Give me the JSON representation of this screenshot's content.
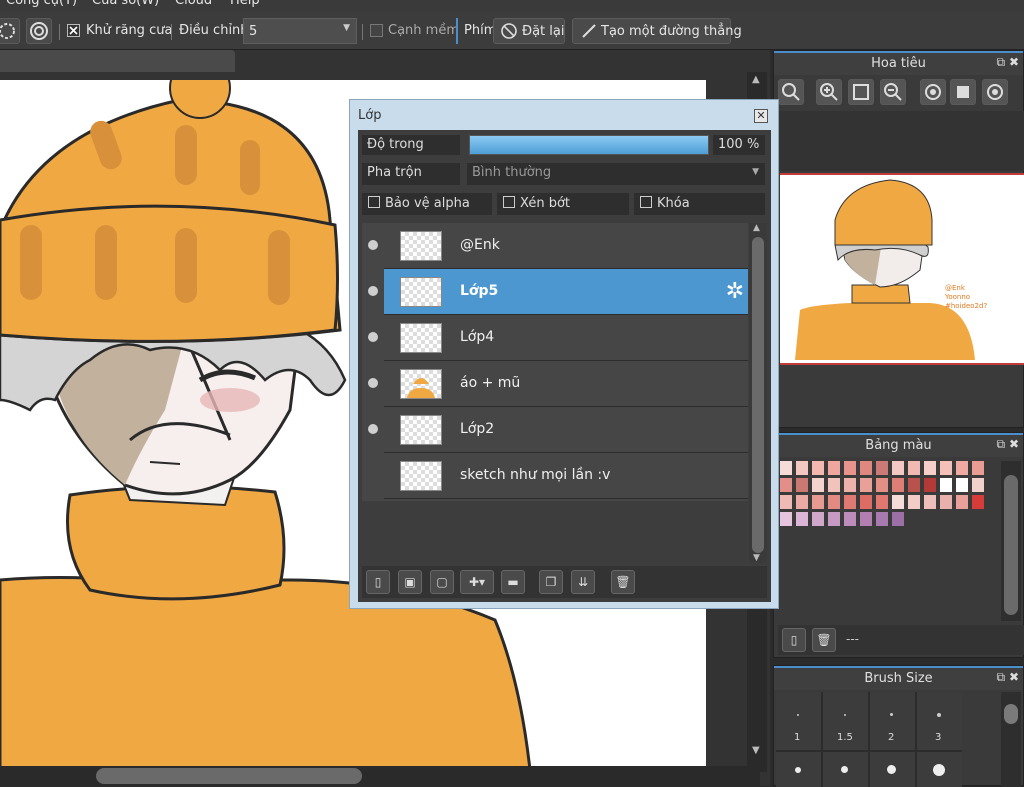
{
  "menubar": {
    "items": [
      "Công cụ(T)",
      "Cửa sổ(W)",
      "Cloud",
      "Help"
    ]
  },
  "toolbar": {
    "antialias_label": "Khử răng cưa",
    "adjust_label": "Điều chỉnh",
    "adjust_value": "5",
    "soft_edge_label": "Cạnh mềm",
    "keys_label": "Phím",
    "reset_label": "Đặt lại",
    "straight_line_label": "Tạo một đường thẳng"
  },
  "navigator": {
    "title": "Hoa tiêu",
    "thumb_text": [
      "@Enk",
      "Yoonno",
      "#hoideo2d?"
    ]
  },
  "palette": {
    "title": "Bảng màu",
    "footer_label": "---",
    "colors": [
      [
        "#f6dcd6",
        "#f2c8c0",
        "#f4b8b0",
        "#eea69e",
        "#e8948c",
        "#e08880",
        "#cc7a76",
        "#f3c9c3",
        "#f0b9b2",
        "#f6cfc8",
        "#f4c0b8",
        "#f0aaa2",
        "#e99c93"
      ],
      [
        "#e38e86",
        "#c97872",
        "#f5d4cd",
        "#f1c3bb",
        "#edb2aa",
        "#e9a098",
        "#e48f86",
        "#de7e74",
        "#b9524c",
        "#b33a36",
        "#ffffff",
        "#ffffff",
        "#f2d0cc"
      ],
      [
        "#efbab4",
        "#ebaaa3",
        "#e79a92",
        "#e38a82",
        "#df7a72",
        "#dc6c64",
        "#e07870",
        "#f6dcd8",
        "#f2cdc8",
        "#eebfba",
        "#eab0ab",
        "#e9a09a",
        "#d83c3a"
      ],
      [
        "#e6c3de",
        "#dcb5d6",
        "#d1a7cc",
        "#c79ac4",
        "#bd8cbb",
        "#b37fb2",
        "#a87ab0",
        "#9c6fa6"
      ]
    ]
  },
  "brush": {
    "title": "Brush Size",
    "sizes": [
      "1",
      "1.5",
      "2",
      "3"
    ]
  },
  "layer_panel": {
    "title": "Lớp",
    "opacity_label": "Độ trong",
    "opacity_value": "100 %",
    "opacity_fraction": 1.0,
    "blend_label": "Pha trộn",
    "blend_value": "Bình thường",
    "protect_alpha_label": "Bảo vệ alpha",
    "clip_label": "Xén bớt",
    "lock_label": "Khóa",
    "layers": [
      {
        "name": "@Enk",
        "visible": true,
        "selected": false
      },
      {
        "name": "Lớp5",
        "visible": true,
        "selected": true
      },
      {
        "name": "Lớp4",
        "visible": true,
        "selected": false
      },
      {
        "name": "áo + mũ",
        "visible": true,
        "selected": false
      },
      {
        "name": "Lớp2",
        "visible": true,
        "selected": false
      },
      {
        "name": "sketch như mọi lần :v",
        "visible": false,
        "selected": false
      }
    ]
  },
  "colors": {
    "accent": "#4d97d0",
    "hat": "#f0a843",
    "panel_bg": "#3a3a3a"
  }
}
